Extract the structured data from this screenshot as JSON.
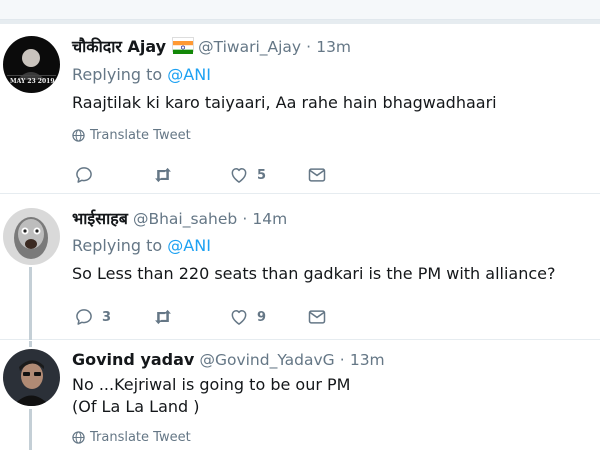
{
  "colors": {
    "link": "#1da1f2",
    "muted": "#657786",
    "divider": "#e6ecf0",
    "thread": "#c4cfd6"
  },
  "tweets": [
    {
      "name": "चौकीदार Ajay",
      "flag": "india-flag-icon",
      "handle": "@Tiwari_Ajay",
      "dot": "·",
      "time": "13m",
      "replying_prefix": "Replying to",
      "replying_to": "@ANI",
      "text": "Raajtilak ki karo taiyaari, Aa rahe hain bhagwadhaari",
      "translate": "Translate Tweet",
      "avatar_text": "MAY 23 2019",
      "actions": {
        "reply_count": "",
        "retweet_count": "",
        "like_count": "5"
      }
    },
    {
      "name": "भाईसाहब",
      "handle": "@Bhai_saheb",
      "dot": "·",
      "time": "14m",
      "replying_prefix": "Replying to",
      "replying_to": "@ANI",
      "text": "So Less than 220 seats than gadkari is the PM with alliance?",
      "actions": {
        "reply_count": "3",
        "retweet_count": "",
        "like_count": "9"
      }
    },
    {
      "name": "Govind yadav",
      "handle": "@Govind_YadavG",
      "dot": "·",
      "time": "13m",
      "text_line1": "No ...Kejriwal is going to be our PM",
      "text_line2": "(Of La La Land )",
      "translate": "Translate Tweet"
    }
  ]
}
